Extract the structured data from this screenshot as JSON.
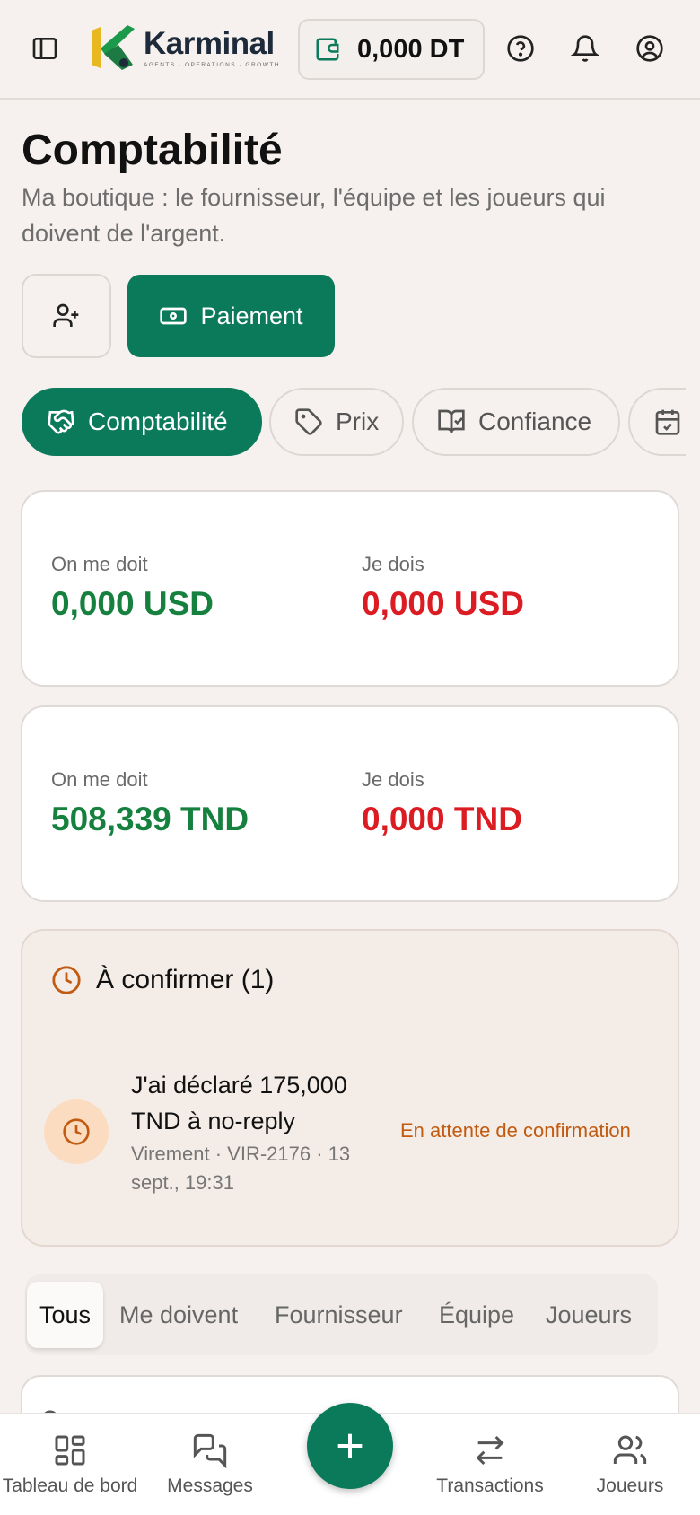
{
  "header": {
    "brand_name": "Karminal",
    "brand_tagline": "AGENTS · OPERATIONS · GROWTH",
    "wallet_balance": "0,000 DT"
  },
  "page": {
    "title": "Comptabilité",
    "subtitle": "Ma boutique : le fournisseur, l'équipe et les joueurs qui doivent de l'argent."
  },
  "actions": {
    "payment_label": "Paiement"
  },
  "chips": [
    {
      "label": "Comptabilité",
      "icon": "handshake-icon",
      "active": true
    },
    {
      "label": "Prix",
      "icon": "tag-icon",
      "active": false
    },
    {
      "label": "Confiance",
      "icon": "book-check-icon",
      "active": false
    },
    {
      "label": "",
      "icon": "calendar-check-icon",
      "active": false
    }
  ],
  "balances": [
    {
      "owed_label": "On me doit",
      "owed_value": "0,000 USD",
      "owe_label": "Je dois",
      "owe_value": "0,000 USD"
    },
    {
      "owed_label": "On me doit",
      "owed_value": "508,339 TND",
      "owe_label": "Je dois",
      "owe_value": "0,000 TND"
    }
  ],
  "pending": {
    "title": "À confirmer (1)",
    "item_title": "J'ai déclaré 175,000 TND à no-reply",
    "item_meta": "Virement · VIR-2176 · 13 sept., 19:31",
    "item_status": "En attente de confirmation"
  },
  "filter_tabs": [
    {
      "label": "Tous",
      "active": true
    },
    {
      "label": "Me doivent",
      "active": false
    },
    {
      "label": "Fournisseur",
      "active": false
    },
    {
      "label": "Équipe",
      "active": false
    },
    {
      "label": "Joueurs",
      "active": false
    }
  ],
  "bottom_nav": [
    {
      "label": "Tableau de bord",
      "icon": "dashboard-icon"
    },
    {
      "label": "Messages",
      "icon": "messages-icon"
    },
    {
      "label": "Transactions",
      "icon": "transfer-icon"
    },
    {
      "label": "Joueurs",
      "icon": "users-icon"
    }
  ],
  "colors": {
    "primary": "#0a7a5a",
    "positive": "#16803f",
    "negative": "#dc1c23",
    "pending": "#c25b12"
  }
}
